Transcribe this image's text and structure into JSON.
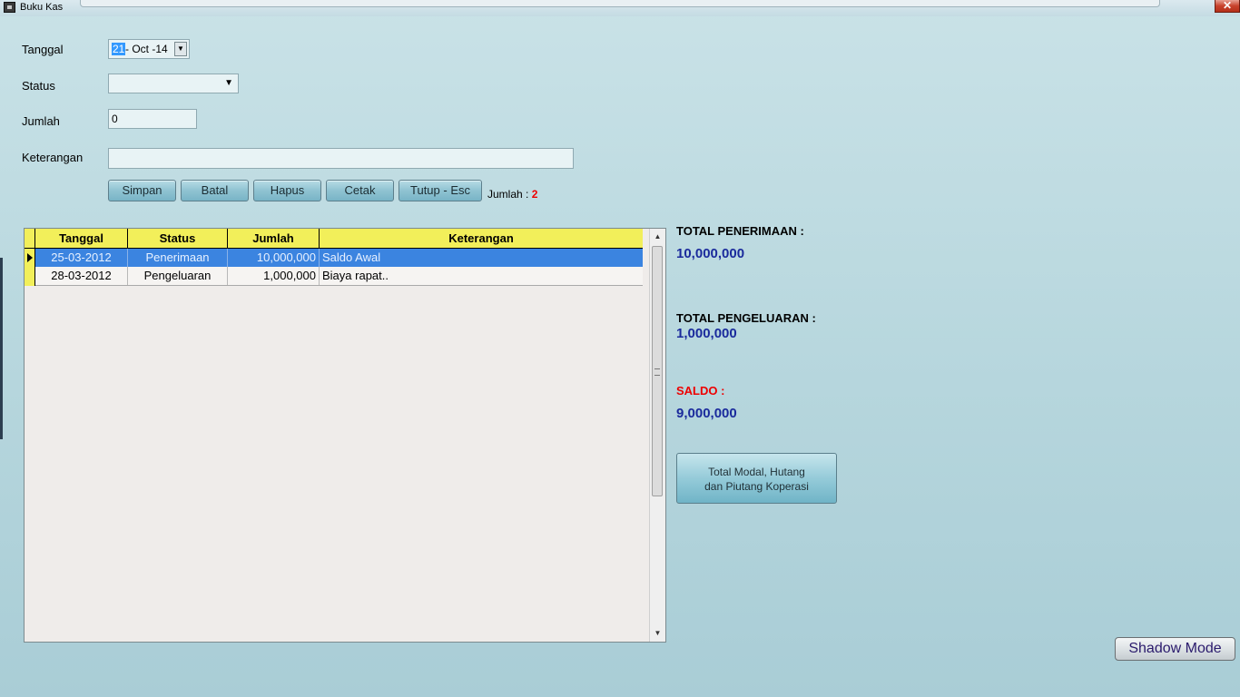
{
  "window": {
    "title": "Buku Kas",
    "close_label": "✕"
  },
  "form": {
    "tanggal_label": "Tanggal",
    "tanggal_day": "21",
    "tanggal_rest": "- Oct -14",
    "status_label": "Status",
    "status_value": "",
    "jumlah_label": "Jumlah",
    "jumlah_value": "0",
    "keterangan_label": "Keterangan",
    "keterangan_value": ""
  },
  "buttons": {
    "simpan": "Simpan",
    "batal": "Batal",
    "hapus": "Hapus",
    "cetak": "Cetak",
    "tutup": "Tutup - Esc"
  },
  "record_count": {
    "label": "Jumlah :",
    "value": "2"
  },
  "grid": {
    "columns": [
      "Tanggal",
      "Status",
      "Jumlah",
      "Keterangan"
    ],
    "rows": [
      {
        "tanggal": "25-03-2012",
        "status": "Penerimaan",
        "jumlah": "10,000,000",
        "keterangan": "Saldo Awal",
        "selected": true
      },
      {
        "tanggal": "28-03-2012",
        "status": "Pengeluaran",
        "jumlah": "1,000,000",
        "keterangan": "Biaya rapat..",
        "selected": false
      }
    ]
  },
  "summary": {
    "penerimaan_label": "TOTAL PENERIMAAN :",
    "penerimaan_value": "10,000,000",
    "pengeluaran_label": "TOTAL PENGELUARAN :",
    "pengeluaran_value": "1,000,000",
    "saldo_label": "SALDO :",
    "saldo_value": "9,000,000"
  },
  "total_modal_button": {
    "line1": "Total Modal, Hutang",
    "line2": "dan Piutang Koperasi"
  },
  "shadow_mode_button": "Shadow Mode",
  "colors": {
    "accent": "#3b84e0",
    "header": "#f2ef5a",
    "saldo": "#ee0000",
    "value": "#1a2a9c"
  }
}
